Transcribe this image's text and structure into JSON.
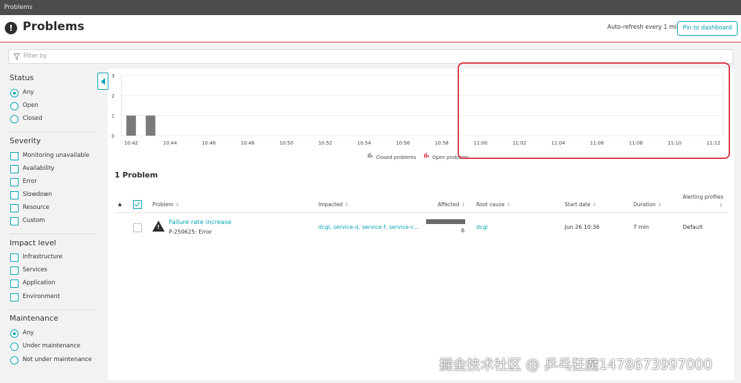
{
  "window": {
    "tab_title": "Problems"
  },
  "header": {
    "title": "Problems",
    "auto_refresh": "Auto-refresh every 1 min",
    "pin_label": "Pin to dashboard",
    "icon": "alert-circle-icon"
  },
  "filter": {
    "placeholder": "Filter by",
    "icon": "funnel-icon"
  },
  "sidebar": {
    "status": {
      "title": "Status",
      "options": [
        {
          "label": "Any",
          "selected": true
        },
        {
          "label": "Open",
          "selected": false
        },
        {
          "label": "Closed",
          "selected": false
        }
      ]
    },
    "severity": {
      "title": "Severity",
      "options": [
        "Monitoring unavailable",
        "Availability",
        "Error",
        "Slowdown",
        "Resource",
        "Custom"
      ]
    },
    "impact": {
      "title": "Impact level",
      "options": [
        "Infrastructure",
        "Services",
        "Application",
        "Environment"
      ]
    },
    "maintenance": {
      "title": "Maintenance",
      "options": [
        {
          "label": "Any",
          "selected": true
        },
        {
          "label": "Under maintenance",
          "selected": false
        },
        {
          "label": "Not under maintenance",
          "selected": false
        }
      ]
    }
  },
  "chart_data": {
    "type": "bar",
    "categories": [
      "10:42",
      "10:43",
      "10:44",
      "10:45",
      "10:46",
      "10:47",
      "10:48",
      "10:49",
      "10:50",
      "10:51",
      "10:52",
      "10:53",
      "10:54",
      "10:55",
      "10:56",
      "10:57",
      "10:58",
      "10:59",
      "11:00",
      "11:01",
      "11:02",
      "11:03",
      "11:04",
      "11:05",
      "11:06",
      "11:07",
      "11:08",
      "11:09",
      "11:10",
      "11:11",
      "11:12"
    ],
    "x_tick_labels": [
      "10:42",
      "10:44",
      "10:46",
      "10:48",
      "10:50",
      "10:52",
      "10:54",
      "10:56",
      "10:58",
      "11:00",
      "11:02",
      "11:04",
      "11:06",
      "11:08",
      "11:10",
      "11:12"
    ],
    "y_ticks": [
      "0",
      "1",
      "2",
      "3"
    ],
    "ylim": [
      0,
      3
    ],
    "series": [
      {
        "name": "Closed problems",
        "color": "#7a7a7a",
        "values": [
          1,
          1,
          0,
          0,
          0,
          0,
          0,
          0,
          0,
          0,
          0,
          0,
          0,
          0,
          0,
          0,
          0,
          0,
          0,
          0,
          0,
          0,
          0,
          0,
          0,
          0,
          0,
          0,
          0,
          0,
          0
        ]
      },
      {
        "name": "Open problems",
        "color": "#dc3545",
        "values": [
          0,
          0,
          0,
          0,
          0,
          0,
          0,
          0,
          0,
          0,
          0,
          0,
          0,
          0,
          0,
          0,
          0,
          0,
          0,
          0,
          0,
          0,
          0,
          0,
          0,
          0,
          0,
          0,
          0,
          0,
          0
        ]
      }
    ],
    "legend_position": "bottom-center",
    "grid": true,
    "title": "",
    "xlabel": "",
    "ylabel": ""
  },
  "problems": {
    "count_label": "1 Problem",
    "columns": {
      "problem": "Problem",
      "impacted": "Impacted",
      "affected": "Affected",
      "root_cause": "Root cause",
      "start_date": "Start date",
      "duration": "Duration",
      "alerting": "Alerting profiles",
      "sort_glyph": "⇕",
      "collapse_glyph": "▲"
    },
    "rows": [
      {
        "title": "Failure rate increase",
        "id": "P-250625: Error",
        "impacted": "dcgl, service-d, service-f, service-c...",
        "affected": "6",
        "affected_fraction": 1.0,
        "root_cause": "dcgl",
        "start_date": "Jun 26 10:36",
        "duration": "7 min",
        "alerting": "Default",
        "icon": "warning-triangle-icon"
      }
    ]
  },
  "watermark": "掘金技术社区 @ 乒乓狂魔1478673997000",
  "colors": {
    "accent": "#00a1b2",
    "highlight": "#dc3545"
  }
}
